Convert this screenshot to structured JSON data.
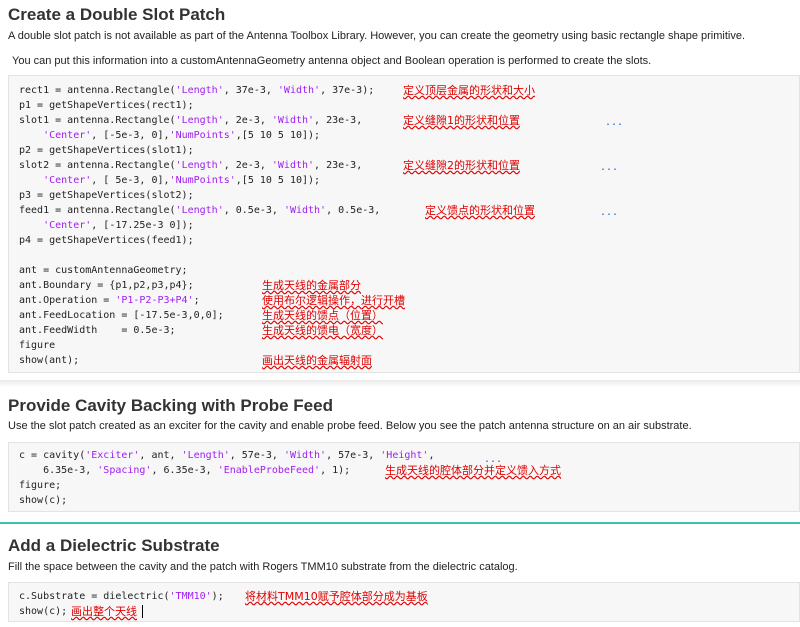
{
  "sections": [
    {
      "title": "Create a Double Slot Patch",
      "desc1": "A double slot patch is not available as part of the Antenna Toolbox Library. However, you can create the geometry using basic rectangle shape primitive.",
      "desc2": "You can put this information into a customAntennaGeometry antenna object and Boolean operation is performed to create the slots.",
      "code": [
        {
          "pre": "rect1 = antenna.Rectangle(",
          "s1": "'Length'",
          "mid": ", 37e-3, ",
          "s2": "'Width'",
          "post": ", 37e-3);"
        },
        {
          "text": "p1 = getShapeVertices(rect1);"
        },
        {
          "pre": "slot1 = antenna.Rectangle(",
          "s1": "'Length'",
          "mid": ", 2e-3, ",
          "s2": "'Width'",
          "post": ", 23e-3,"
        },
        {
          "pre": "    ",
          "s1": "'Center'",
          "mid": ", [-5e-3, 0],",
          "s2": "'NumPoints'",
          "post": ",[5 10 5 10]);"
        },
        {
          "text": "p2 = getShapeVertices(slot1);"
        },
        {
          "pre": "slot2 = antenna.Rectangle(",
          "s1": "'Length'",
          "mid": ", 2e-3, ",
          "s2": "'Width'",
          "post": ", 23e-3,"
        },
        {
          "pre": "    ",
          "s1": "'Center'",
          "mid": ", [ 5e-3, 0],",
          "s2": "'NumPoints'",
          "post": ",[5 10 5 10]);"
        },
        {
          "text": "p3 = getShapeVertices(slot2);"
        },
        {
          "pre": "feed1 = antenna.Rectangle(",
          "s1": "'Length'",
          "mid": ", 0.5e-3, ",
          "s2": "'Width'",
          "post": ", 0.5e-3,"
        },
        {
          "pre": "    ",
          "s1": "'Center'",
          "mid": ", [-17.25e-3 0]);",
          "s2": "",
          "post": ""
        },
        {
          "text": "p4 = getShapeVertices(feed1);"
        },
        {
          "text": ""
        },
        {
          "text": "ant = customAntennaGeometry;"
        },
        {
          "text": "ant.Boundary = {p1,p2,p3,p4};"
        },
        {
          "pre": "ant.Operation = ",
          "s1": "'P1-P2-P3+P4'",
          "mid": ";",
          "s2": "",
          "post": ""
        },
        {
          "text": "ant.FeedLocation = [-17.5e-3,0,0];"
        },
        {
          "text": "ant.FeedWidth    = 0.5e-3;"
        },
        {
          "text": "figure"
        },
        {
          "text": "show(ant);"
        }
      ],
      "notes": [
        "定义顶层金属的形状和大小",
        "定义缝隙1的形状和位置",
        "定义缝隙2的形状和位置",
        "定义馈点的形状和位置",
        "生成天线的金属部分",
        "使用布尔逻辑操作，进行开槽",
        "生成天线的馈点（位置）",
        "生成天线的馈电（宽度）",
        "画出天线的金属辐射面"
      ],
      "ellipsis": "..."
    },
    {
      "title": "Provide Cavity Backing with Probe Feed",
      "desc1": "Use the slot patch created as an exciter for the cavity and enable probe feed. Below you see the patch antenna structure on an air substrate.",
      "code": [
        {
          "pre": "c = cavity(",
          "s1": "'Exciter'",
          "mid": ", ant, ",
          "s2": "'Length'",
          "post": ", 57e-3, "
        },
        {
          "pre": "    6.35e-3, ",
          "s1": "'Spacing'",
          "mid": ", 6.35e-3, ",
          "s2": "'EnableProbeFeed'",
          "post": ", 1);"
        },
        {
          "text": "figure;"
        },
        {
          "text": "show(c);"
        }
      ],
      "line0_extra_s": "'Width'",
      "line0_extra_mid": ", 57e-3, ",
      "line0_extra_s2": "'Height'",
      "line0_extra_post": ",",
      "notes": [
        "生成天线的腔体部分并定义馈入方式"
      ],
      "ellipsis": "..."
    },
    {
      "title": "Add a Dielectric Substrate",
      "desc1": "Fill the space between the cavity and the patch with Rogers TMM10 substrate from the dielectric catalog.",
      "code": [
        {
          "pre": "c.Substrate = dielectric(",
          "s1": "'TMM10'",
          "mid": ");",
          "s2": "",
          "post": ""
        },
        {
          "text": "show(c);"
        }
      ],
      "notes": [
        "将材料TMM10赋予腔体部分成为基板",
        "画出整个天线"
      ]
    }
  ]
}
